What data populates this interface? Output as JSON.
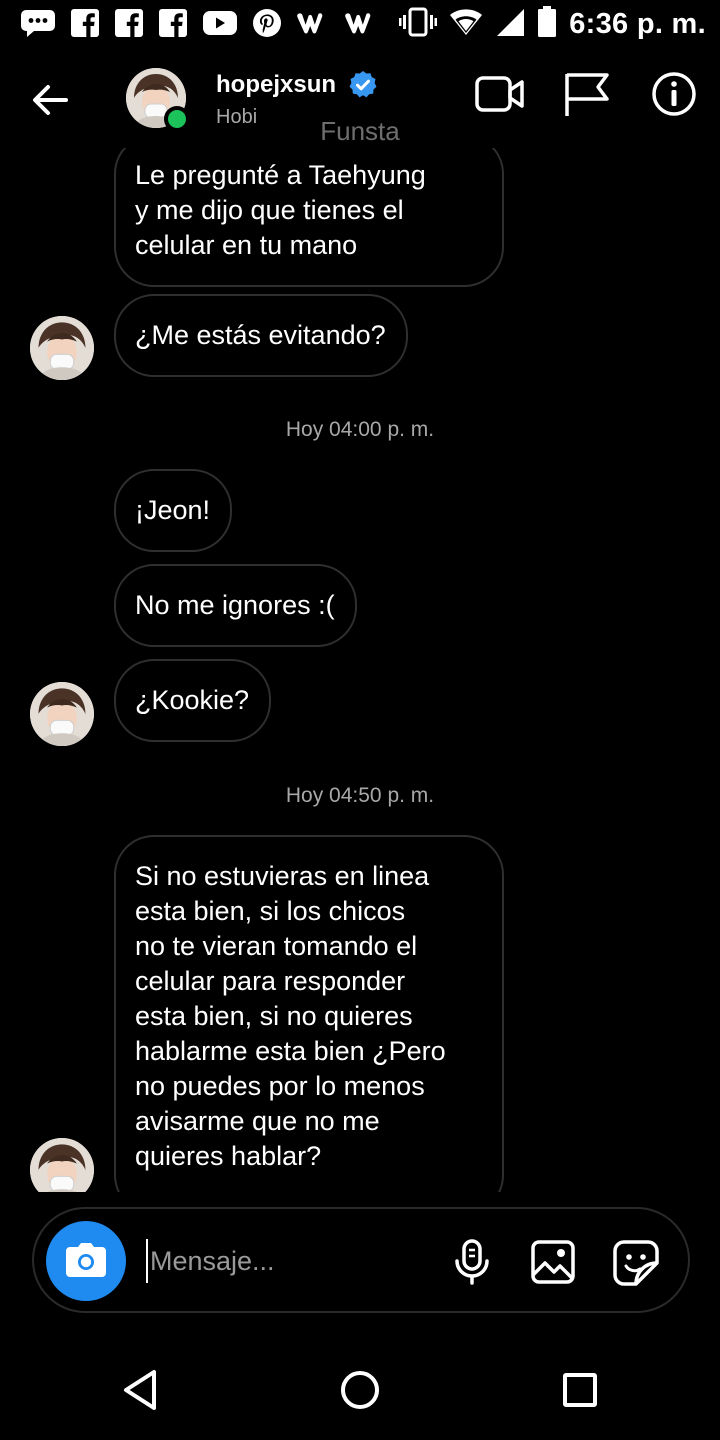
{
  "status_bar": {
    "time": "6:36 p. m.",
    "icons": [
      "chat-bubble-icon",
      "facebook-icon",
      "facebook-icon",
      "facebook-icon",
      "youtube-icon",
      "pinterest-icon",
      "wattpad-icon",
      "wattpad-icon",
      "vibrate-icon",
      "wifi-icon",
      "signal-icon",
      "battery-icon"
    ]
  },
  "header": {
    "username": "hopejxsun",
    "display_name": "Hobi",
    "verified": true,
    "subtitle": "Funsta",
    "online_color": "#1bc35a",
    "verified_color": "#3897f0"
  },
  "messages": [
    {
      "type": "message",
      "text": "Le pregunté a Taehyung\ny me dijo que tienes el\ncelular en tu mano"
    },
    {
      "type": "message",
      "text": "¿Me estás evitando?"
    },
    {
      "type": "timestamp",
      "text": "Hoy 04:00 p. m."
    },
    {
      "type": "message",
      "text": "¡Jeon!"
    },
    {
      "type": "message",
      "text": "No me ignores :("
    },
    {
      "type": "message",
      "text": "¿Kookie?"
    },
    {
      "type": "timestamp",
      "text": "Hoy 04:50 p. m."
    },
    {
      "type": "message",
      "text": "Si no estuvieras en linea\nesta bien, si los chicos\nno te vieran tomando el\ncelular para responder\nesta bien, si no quieres\nhablarme esta bien ¿Pero\nno puedes por lo menos\navisarme que no me\nquieres hablar?"
    }
  ],
  "composer": {
    "placeholder": "Mensaje...",
    "accent": "#1f8bf0"
  },
  "nav": {
    "buttons": [
      "back-triangle-icon",
      "home-circle-icon",
      "recents-square-icon"
    ]
  }
}
